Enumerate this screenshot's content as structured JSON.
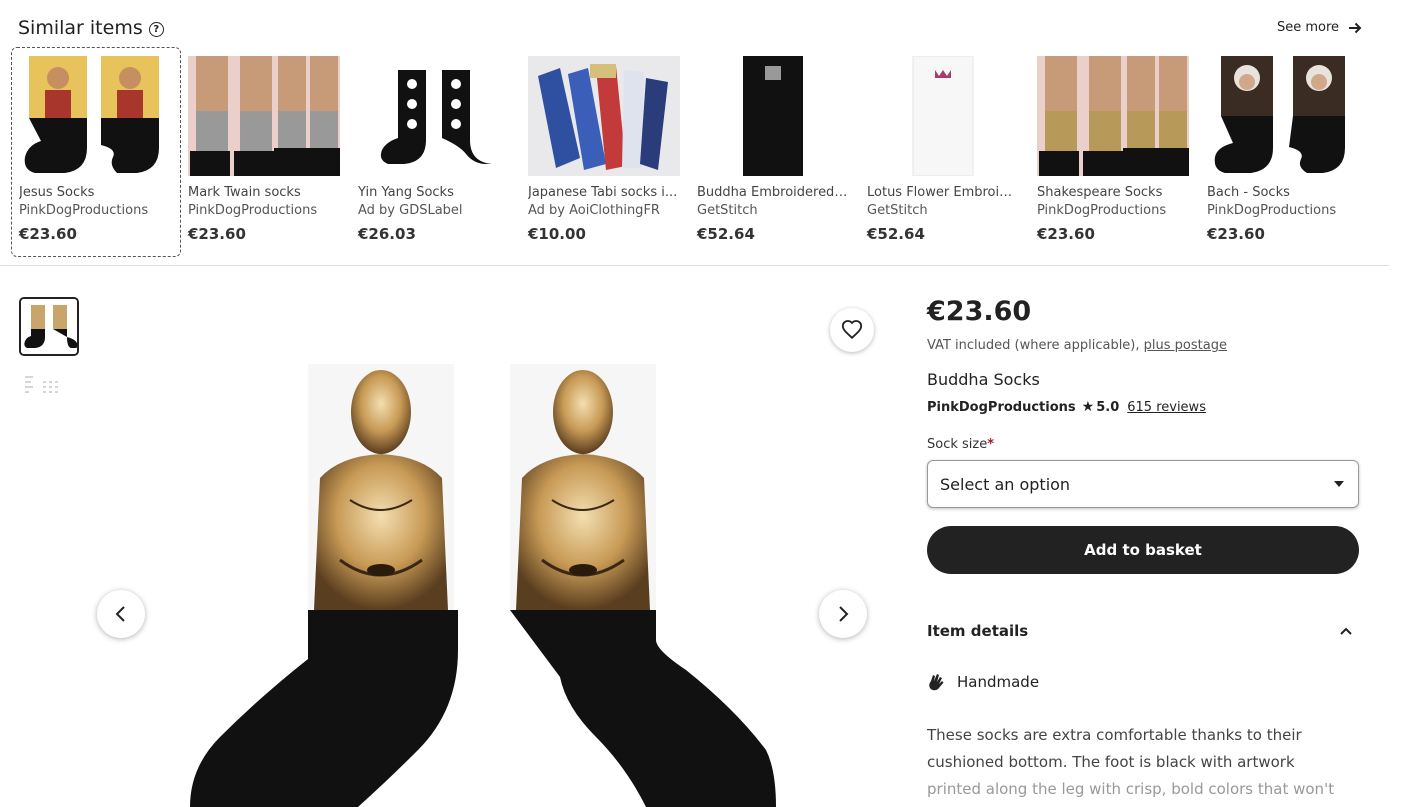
{
  "similar": {
    "title": "Similar items",
    "help_icon": "question-circle-icon",
    "see_more": "See more",
    "items": [
      {
        "title": "Jesus Socks",
        "shop": "PinkDogProductions",
        "price": "€23.60"
      },
      {
        "title": "Mark Twain socks",
        "shop": "PinkDogProductions",
        "price": "€23.60"
      },
      {
        "title": "Yin Yang Socks",
        "shop": "Ad by GDSLabel",
        "price": "€26.03"
      },
      {
        "title": "Japanese Tabi socks i...",
        "shop": "Ad by AoiClothingFR",
        "price": "€10.00"
      },
      {
        "title": "Buddha Embroidered ...",
        "shop": "GetStitch",
        "price": "€52.64"
      },
      {
        "title": "Lotus Flower Embroid...",
        "shop": "GetStitch",
        "price": "€52.64"
      },
      {
        "title": "Shakespeare Socks",
        "shop": "PinkDogProductions",
        "price": "€23.60"
      },
      {
        "title": "Bach - Socks",
        "shop": "PinkDogProductions",
        "price": "€23.60"
      }
    ]
  },
  "product": {
    "price": "€23.60",
    "vat_text": "VAT included (where applicable),",
    "postage_link": "plus postage",
    "title": "Buddha Socks",
    "shop_name": "PinkDogProductions",
    "rating": "5.0",
    "reviews": "615 reviews",
    "size_label": "Sock size",
    "size_required": "*",
    "select_placeholder": "Select an option",
    "add_to_basket": "Add to basket",
    "item_details": "Item details",
    "handmade": "Handmade",
    "description_line1": "These socks are extra comfortable thanks to their",
    "description_line2": "cushioned bottom. The foot is black with artwork",
    "description_line3": "printed along the leg with crisp, bold colors that won't"
  },
  "colors": {
    "primary_button": "#222222",
    "required_star": "#a61a2e"
  }
}
